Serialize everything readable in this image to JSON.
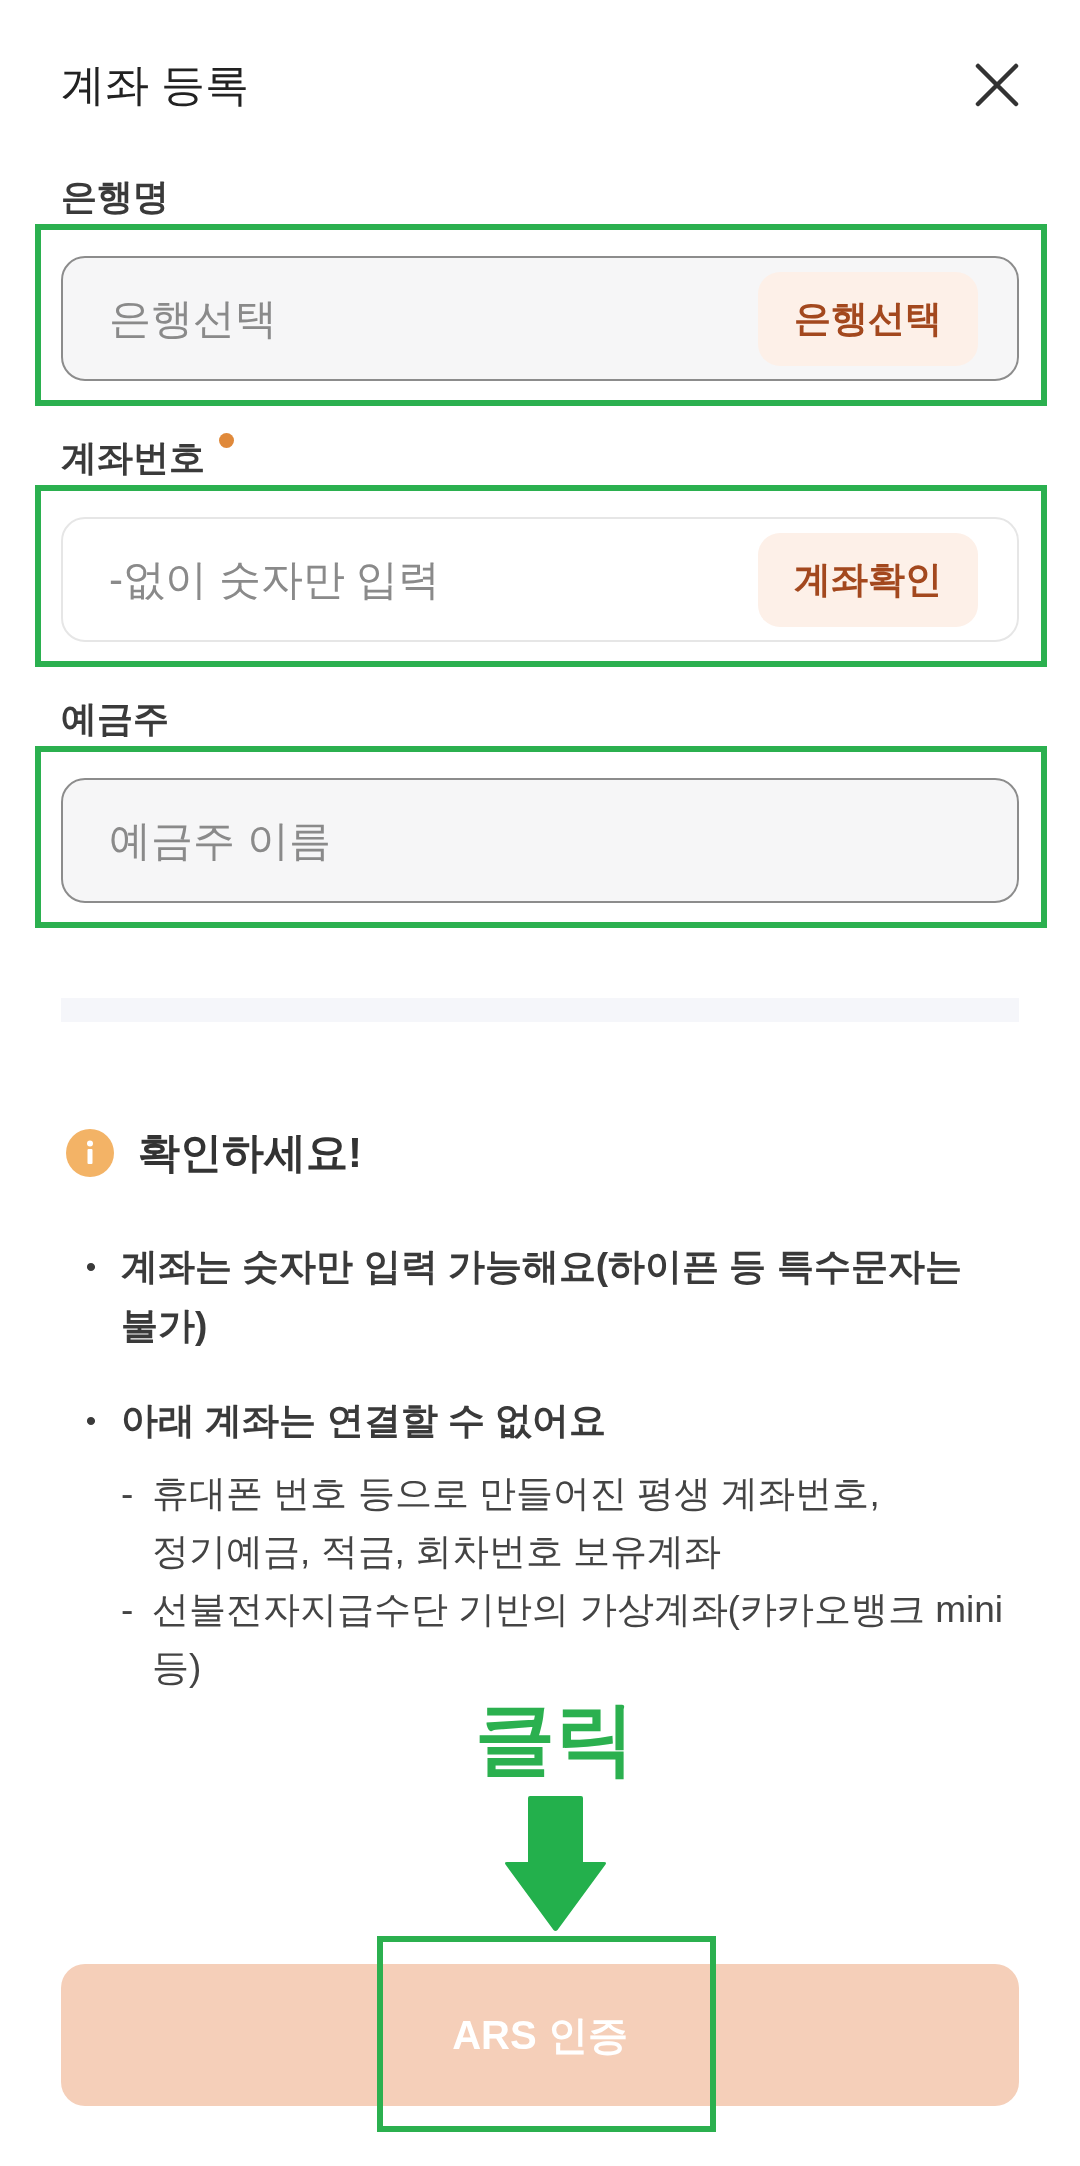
{
  "header": {
    "title": "계좌 등록"
  },
  "fields": [
    {
      "label": "은행명",
      "required": false,
      "placeholder": "은행선택",
      "readonly": true,
      "action": "은행선택",
      "highlighted": true
    },
    {
      "label": "계좌번호",
      "required": true,
      "placeholder": "-없이 숫자만 입력",
      "readonly": false,
      "action": "계좌확인",
      "highlighted": true
    },
    {
      "label": "예금주",
      "required": false,
      "placeholder": "예금주 이름",
      "readonly": true,
      "highlighted": true
    }
  ],
  "notice": {
    "title": "확인하세요!",
    "items": [
      {
        "marker": "•",
        "text": "계좌는 숫자만 입력 가능해요(하이픈 등 특수문자는 불가)"
      },
      {
        "marker": "•",
        "text": "아래 계좌는 연결할 수 없어요",
        "children": [
          {
            "marker": "-",
            "text": "휴대폰 번호 등으로 만들어진 평생 계좌번호, 정기예금, 적금, 회차번호 보유계좌"
          },
          {
            "marker": "-",
            "text": "선불전자지급수단 기반의 가상계좌(카카오뱅크 mini 등)"
          }
        ]
      }
    ]
  },
  "callout": {
    "text": "클릭"
  },
  "submit": {
    "label": "ARS 인증",
    "disabled": true,
    "highlighted": true
  }
}
